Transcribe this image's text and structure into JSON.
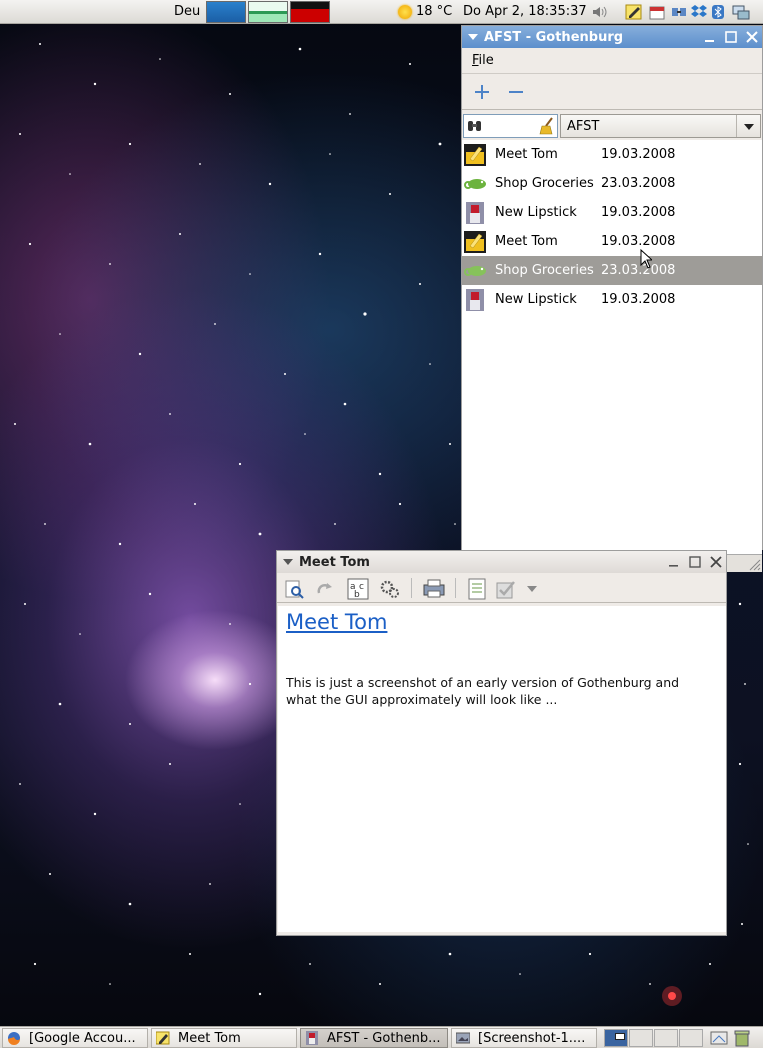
{
  "top_panel": {
    "keyboard_layout": "Deu",
    "weather": {
      "icon": "sun-icon",
      "temperature": "18 °C"
    },
    "clock": "Do Apr  2, 18:35:37",
    "tray_icons": [
      "volume-icon",
      "tomboy-note-icon",
      "calendar-applet-icon",
      "network-icon",
      "dropbox-icon",
      "bluetooth-icon",
      "display-icon"
    ]
  },
  "afst_window": {
    "title": "AFST - Gothenburg",
    "menu": {
      "file": "File"
    },
    "toolbar": {
      "add_icon": "plus-icon",
      "remove_icon": "minus-icon"
    },
    "filter": {
      "search_value": "",
      "combo_value": "AFST"
    },
    "items": [
      {
        "name": "Meet Tom",
        "date": "19.03.2008",
        "icon": "note-folder-icon"
      },
      {
        "name": "Shop Groceries",
        "date": "23.03.2008",
        "icon": "chameleon-icon"
      },
      {
        "name": "New Lipstick",
        "date": "19.03.2008",
        "icon": "lipstick-icon"
      },
      {
        "name": "Meet Tom",
        "date": "19.03.2008",
        "icon": "note-folder-icon"
      },
      {
        "name": "Shop Groceries",
        "date": "23.03.2008",
        "icon": "chameleon-icon",
        "selected": true
      },
      {
        "name": "New Lipstick",
        "date": "19.03.2008",
        "icon": "lipstick-icon"
      }
    ]
  },
  "note_window": {
    "title": "Meet Tom",
    "toolbar_icons": [
      "find-icon",
      "redo-icon",
      "spellcheck-icon",
      "settings-icon",
      "print-icon",
      "notes-icon",
      "checkbox-icon",
      "dropdown-icon"
    ],
    "heading": "Meet Tom",
    "body": "This is just a screenshot of an early version of Gothenburg and what the GUI approximately will look like ..."
  },
  "taskbar": {
    "tasks": [
      {
        "label": "[Google Accou...",
        "icon": "firefox-icon"
      },
      {
        "label": "Meet Tom",
        "icon": "note-icon"
      },
      {
        "label": "AFST - Gothenb...",
        "icon": "lipstick-icon",
        "active": true
      },
      {
        "label": "[Screenshot-1....",
        "icon": "screenshot-icon"
      }
    ],
    "workspaces": 4,
    "current_workspace": 1
  },
  "colors": {
    "selection": "#9e9c98",
    "title_active": "#6f9ad2",
    "link": "#1b5fc6"
  }
}
